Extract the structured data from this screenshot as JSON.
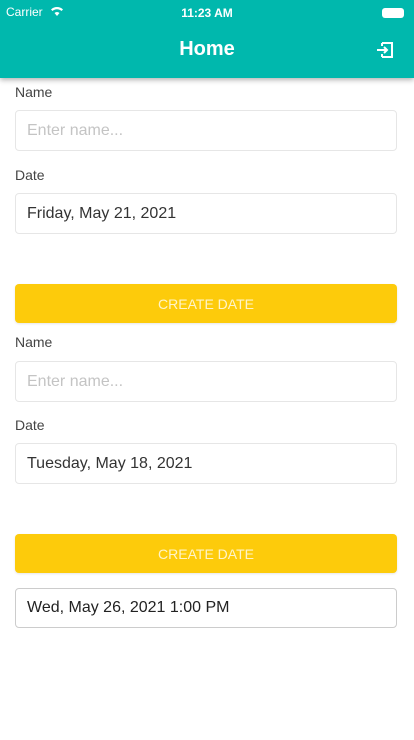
{
  "status": {
    "carrier": "Carrier",
    "time": "11:23 AM"
  },
  "header": {
    "title": "Home",
    "logout_icon": "logout-icon"
  },
  "forms": [
    {
      "name_label": "Name",
      "name_placeholder": "Enter name...",
      "date_label": "Date",
      "date_value": "Friday, May 21, 2021",
      "button": "CREATE DATE"
    },
    {
      "name_label": "Name",
      "name_placeholder": "Enter name...",
      "date_label": "Date",
      "date_value": "Tuesday, May 18, 2021",
      "button": "CREATE DATE"
    }
  ],
  "picker_value": "Wed, May 26, 2021 1:00 PM",
  "colors": {
    "header": "#00b8ad",
    "button": "#fdcb0b"
  }
}
